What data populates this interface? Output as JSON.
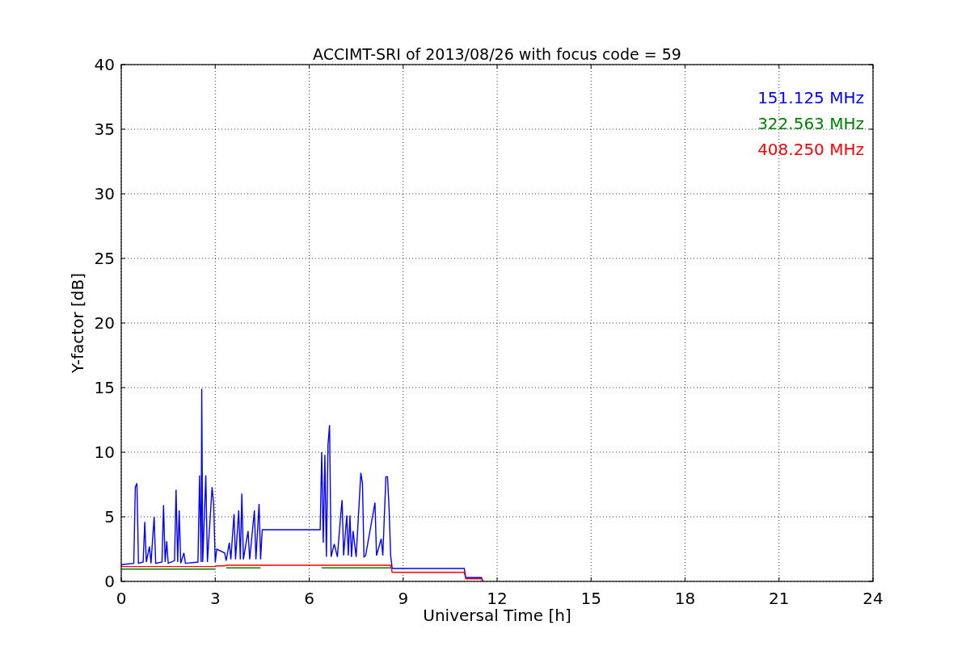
{
  "figure": {
    "chart_data": {
      "type": "line",
      "grid": true,
      "title": "ACCIMT-SRI of 2013/08/26 with focus code = 59",
      "xlabel": "Universal Time [h]",
      "ylabel": "Y-factor [dB]",
      "xlim": [
        0,
        24
      ],
      "ylim": [
        0,
        40
      ],
      "xticks": [
        0,
        3,
        6,
        9,
        12,
        15,
        18,
        21,
        24
      ],
      "yticks": [
        0,
        5,
        10,
        15,
        20,
        25,
        30,
        35,
        40
      ],
      "x": [
        0,
        0.4,
        0.45,
        0.5,
        0.55,
        0.7,
        0.75,
        0.8,
        0.9,
        0.95,
        1.05,
        1.1,
        1.3,
        1.35,
        1.4,
        1.45,
        1.5,
        1.7,
        1.75,
        1.8,
        1.85,
        1.9,
        2.0,
        2.05,
        2.45,
        2.5,
        2.55,
        2.57,
        2.6,
        2.7,
        2.75,
        2.9,
        2.95,
        3.0,
        3.05,
        3.3,
        3.35,
        3.45,
        3.5,
        3.6,
        3.65,
        3.75,
        3.8,
        3.85,
        3.9,
        4.05,
        4.1,
        4.25,
        4.3,
        4.4,
        4.45,
        4.5,
        6.35,
        6.4,
        6.45,
        6.5,
        6.55,
        6.6,
        6.65,
        6.7,
        6.8,
        6.9,
        7.0,
        7.05,
        7.1,
        7.2,
        7.25,
        7.3,
        7.35,
        7.4,
        7.5,
        7.65,
        7.7,
        7.75,
        7.8,
        8.1,
        8.15,
        8.3,
        8.35,
        8.45,
        8.5,
        8.55,
        8.6,
        8.65,
        10.95,
        11.0,
        11.5,
        11.55
      ],
      "series": [
        {
          "name": "151.125 MHz",
          "color": "#0000ff",
          "values": [
            1.3,
            1.4,
            7.3,
            7.6,
            1.4,
            1.5,
            4.6,
            1.5,
            2.7,
            1.4,
            5.0,
            1.4,
            1.5,
            5.9,
            1.5,
            3.1,
            1.4,
            1.6,
            7.1,
            1.5,
            5.5,
            1.4,
            2.2,
            1.4,
            1.5,
            8.2,
            1.5,
            14.9,
            1.5,
            8.2,
            1.5,
            7.3,
            6.0,
            1.5,
            2.5,
            2.2,
            1.6,
            3.0,
            1.7,
            5.2,
            1.7,
            5.5,
            1.7,
            6.8,
            1.7,
            3.9,
            1.7,
            5.5,
            1.7,
            6.0,
            1.7,
            4.0,
            4.0,
            10.0,
            3.0,
            9.8,
            1.9,
            10.6,
            12.1,
            1.9,
            2.9,
            1.9,
            5.0,
            6.3,
            2.0,
            5.1,
            2.0,
            5.1,
            1.9,
            3.9,
            1.9,
            8.4,
            7.6,
            1.9,
            2.0,
            6.1,
            2.0,
            3.3,
            2.0,
            8.1,
            8.1,
            5.7,
            2.0,
            1.0,
            1.0,
            0.3,
            0.3,
            0.0
          ]
        },
        {
          "name": "322.563 MHz",
          "color": "#008000",
          "values": [
            0.95,
            0.95,
            0.95,
            0.95,
            0.95,
            0.95,
            0.95,
            0.95,
            0.95,
            0.95,
            0.95,
            0.95,
            0.95,
            0.95,
            0.95,
            0.95,
            0.95,
            0.95,
            0.95,
            0.95,
            0.95,
            0.95,
            0.95,
            0.95,
            0.95,
            0.95,
            0.95,
            0.95,
            0.95,
            0.95,
            0.95,
            0.95,
            0.95,
            0.95,
            null,
            null,
            1.05,
            1.05,
            1.05,
            1.05,
            1.05,
            1.05,
            1.05,
            1.05,
            1.05,
            1.05,
            1.05,
            1.05,
            1.05,
            1.05,
            1.05,
            null,
            null,
            1.05,
            1.05,
            1.05,
            1.05,
            1.05,
            1.05,
            1.05,
            1.05,
            1.05,
            1.05,
            1.05,
            1.05,
            1.05,
            1.05,
            1.05,
            1.05,
            1.05,
            1.05,
            1.05,
            1.05,
            1.05,
            1.05,
            1.05,
            1.05,
            1.05,
            1.05,
            1.05,
            1.05,
            1.05,
            1.05,
            null,
            null,
            null,
            null,
            null
          ]
        },
        {
          "name": "408.250 MHz",
          "color": "#ff0000",
          "values": [
            1.15,
            1.15,
            1.15,
            1.15,
            1.15,
            1.15,
            1.15,
            1.15,
            1.15,
            1.15,
            1.15,
            1.15,
            1.15,
            1.15,
            1.15,
            1.15,
            1.15,
            1.15,
            1.15,
            1.15,
            1.15,
            1.15,
            1.15,
            1.15,
            1.15,
            1.15,
            1.15,
            1.15,
            1.15,
            1.15,
            1.15,
            1.15,
            1.15,
            1.15,
            1.2,
            1.2,
            1.25,
            1.25,
            1.25,
            1.25,
            1.25,
            1.25,
            1.25,
            1.25,
            1.25,
            1.25,
            1.25,
            1.25,
            1.25,
            1.25,
            1.25,
            1.25,
            1.25,
            1.25,
            1.25,
            1.25,
            1.25,
            1.25,
            1.25,
            1.25,
            1.25,
            1.25,
            1.25,
            1.25,
            1.25,
            1.25,
            1.25,
            1.25,
            1.25,
            1.25,
            1.25,
            1.25,
            1.25,
            1.25,
            1.25,
            1.25,
            1.25,
            1.25,
            1.25,
            1.25,
            1.25,
            1.25,
            1.25,
            0.7,
            0.7,
            0.2,
            0.2,
            0.0
          ]
        }
      ]
    }
  }
}
